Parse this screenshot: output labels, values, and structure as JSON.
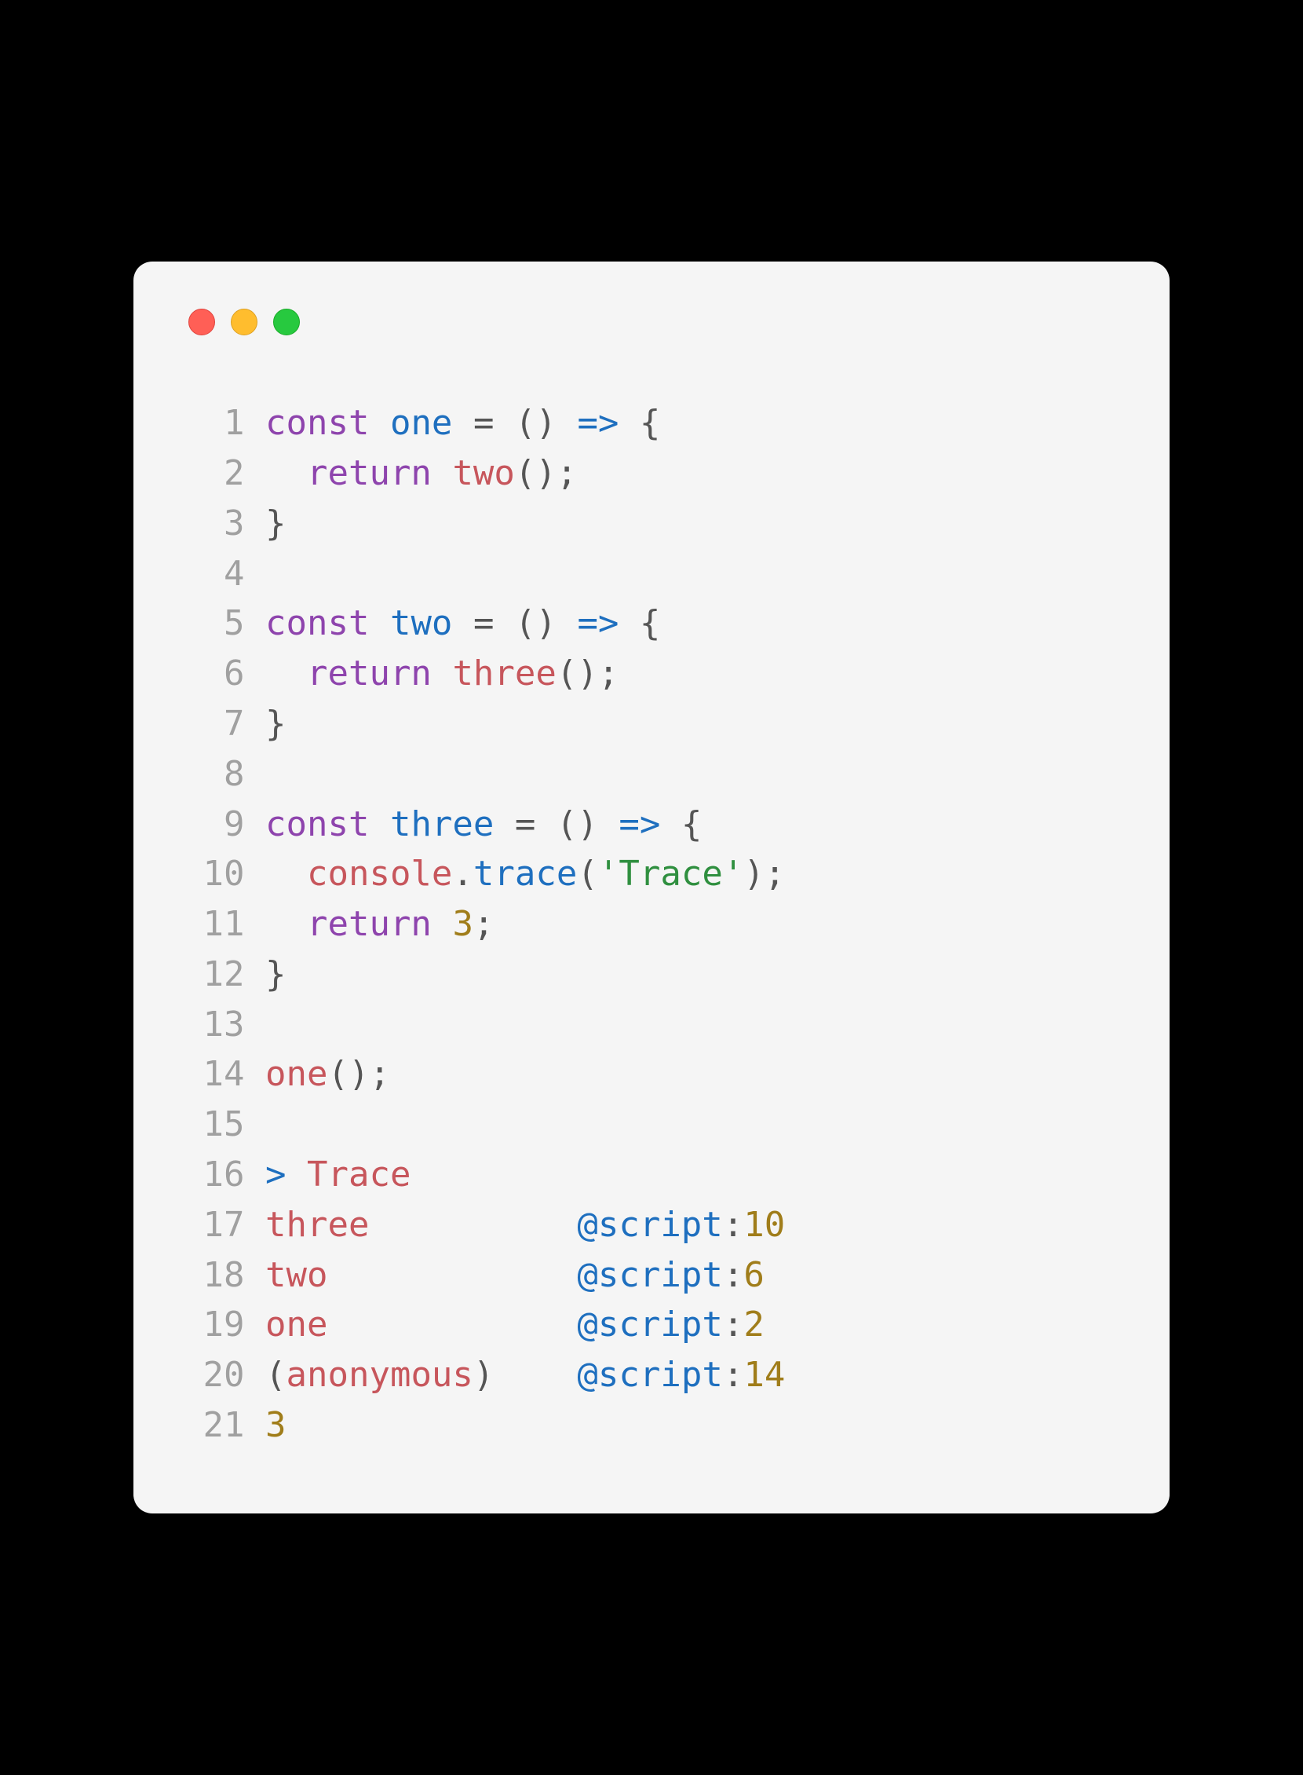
{
  "window": {
    "traffic_lights": [
      "close",
      "minimize",
      "zoom"
    ]
  },
  "code": {
    "lines": [
      {
        "n": 1,
        "tokens": [
          [
            "kw",
            "const"
          ],
          [
            "plain",
            " "
          ],
          [
            "fn",
            "one"
          ],
          [
            "plain",
            " "
          ],
          [
            "punc",
            "="
          ],
          [
            "plain",
            " "
          ],
          [
            "punc",
            "("
          ],
          [
            "punc",
            ")"
          ],
          [
            "plain",
            " "
          ],
          [
            "op",
            "=>"
          ],
          [
            "plain",
            " "
          ],
          [
            "punc",
            "{"
          ]
        ]
      },
      {
        "n": 2,
        "tokens": [
          [
            "plain",
            "  "
          ],
          [
            "kw",
            "return"
          ],
          [
            "plain",
            " "
          ],
          [
            "name",
            "two"
          ],
          [
            "punc",
            "("
          ],
          [
            "punc",
            ")"
          ],
          [
            "punc",
            ";"
          ]
        ]
      },
      {
        "n": 3,
        "tokens": [
          [
            "punc",
            "}"
          ]
        ]
      },
      {
        "n": 4,
        "tokens": []
      },
      {
        "n": 5,
        "tokens": [
          [
            "kw",
            "const"
          ],
          [
            "plain",
            " "
          ],
          [
            "fn",
            "two"
          ],
          [
            "plain",
            " "
          ],
          [
            "punc",
            "="
          ],
          [
            "plain",
            " "
          ],
          [
            "punc",
            "("
          ],
          [
            "punc",
            ")"
          ],
          [
            "plain",
            " "
          ],
          [
            "op",
            "=>"
          ],
          [
            "plain",
            " "
          ],
          [
            "punc",
            "{"
          ]
        ]
      },
      {
        "n": 6,
        "tokens": [
          [
            "plain",
            "  "
          ],
          [
            "kw",
            "return"
          ],
          [
            "plain",
            " "
          ],
          [
            "name",
            "three"
          ],
          [
            "punc",
            "("
          ],
          [
            "punc",
            ")"
          ],
          [
            "punc",
            ";"
          ]
        ]
      },
      {
        "n": 7,
        "tokens": [
          [
            "punc",
            "}"
          ]
        ]
      },
      {
        "n": 8,
        "tokens": []
      },
      {
        "n": 9,
        "tokens": [
          [
            "kw",
            "const"
          ],
          [
            "plain",
            " "
          ],
          [
            "fn",
            "three"
          ],
          [
            "plain",
            " "
          ],
          [
            "punc",
            "="
          ],
          [
            "plain",
            " "
          ],
          [
            "punc",
            "("
          ],
          [
            "punc",
            ")"
          ],
          [
            "plain",
            " "
          ],
          [
            "op",
            "=>"
          ],
          [
            "plain",
            " "
          ],
          [
            "punc",
            "{"
          ]
        ]
      },
      {
        "n": 10,
        "tokens": [
          [
            "plain",
            "  "
          ],
          [
            "name",
            "console"
          ],
          [
            "punc",
            "."
          ],
          [
            "fn",
            "trace"
          ],
          [
            "punc",
            "("
          ],
          [
            "str",
            "'Trace'"
          ],
          [
            "punc",
            ")"
          ],
          [
            "punc",
            ";"
          ]
        ]
      },
      {
        "n": 11,
        "tokens": [
          [
            "plain",
            "  "
          ],
          [
            "kw",
            "return"
          ],
          [
            "plain",
            " "
          ],
          [
            "num",
            "3"
          ],
          [
            "punc",
            ";"
          ]
        ]
      },
      {
        "n": 12,
        "tokens": [
          [
            "punc",
            "}"
          ]
        ]
      },
      {
        "n": 13,
        "tokens": []
      },
      {
        "n": 14,
        "tokens": [
          [
            "name",
            "one"
          ],
          [
            "punc",
            "("
          ],
          [
            "punc",
            ")"
          ],
          [
            "punc",
            ";"
          ]
        ]
      },
      {
        "n": 15,
        "tokens": []
      },
      {
        "n": 16,
        "tokens": [
          [
            "gt",
            ">"
          ],
          [
            "plain",
            " "
          ],
          [
            "name",
            "Trace"
          ]
        ]
      },
      {
        "n": 17,
        "tokens": [
          [
            "name",
            "three"
          ],
          [
            "plain",
            "          "
          ],
          [
            "at",
            "@script"
          ],
          [
            "colon",
            ":"
          ],
          [
            "num",
            "10"
          ]
        ]
      },
      {
        "n": 18,
        "tokens": [
          [
            "name",
            "two"
          ],
          [
            "plain",
            "            "
          ],
          [
            "at",
            "@script"
          ],
          [
            "colon",
            ":"
          ],
          [
            "num",
            "6"
          ]
        ]
      },
      {
        "n": 19,
        "tokens": [
          [
            "name",
            "one"
          ],
          [
            "plain",
            "            "
          ],
          [
            "at",
            "@script"
          ],
          [
            "colon",
            ":"
          ],
          [
            "num",
            "2"
          ]
        ]
      },
      {
        "n": 20,
        "tokens": [
          [
            "punc",
            "("
          ],
          [
            "anon",
            "anonymous"
          ],
          [
            "punc",
            ")"
          ],
          [
            "plain",
            "    "
          ],
          [
            "at",
            "@script"
          ],
          [
            "colon",
            ":"
          ],
          [
            "num",
            "14"
          ]
        ]
      },
      {
        "n": 21,
        "tokens": [
          [
            "num",
            "3"
          ]
        ]
      }
    ]
  }
}
